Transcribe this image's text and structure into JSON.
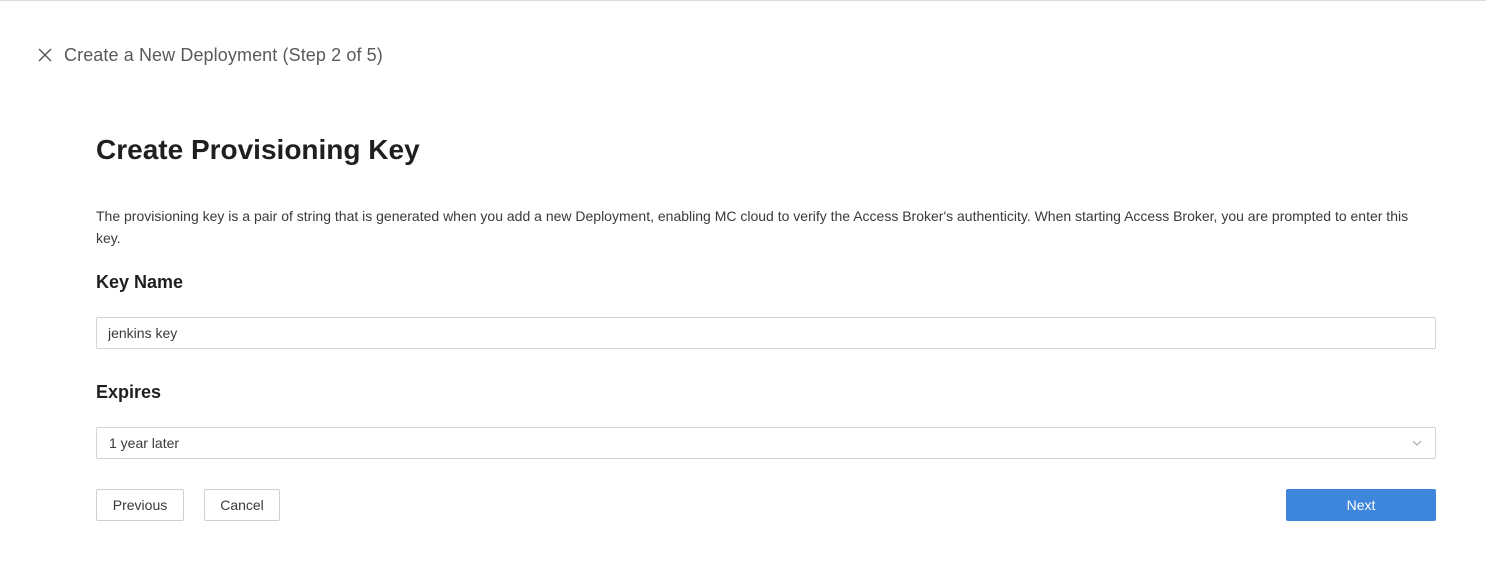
{
  "header": {
    "title": "Create a New Deployment (Step 2 of 5)",
    "close_icon": "close-icon"
  },
  "page": {
    "title": "Create Provisioning Key",
    "description": "The provisioning key is a pair of string that is generated when you add a new Deployment, enabling MC cloud to verify the Access Broker's authenticity. When starting Access Broker, you are prompted to enter this key."
  },
  "form": {
    "key_name": {
      "label": "Key Name",
      "value": "jenkins key"
    },
    "expires": {
      "label": "Expires",
      "selected": "1 year later",
      "icon": "chevron-down-icon"
    }
  },
  "actions": {
    "previous_label": "Previous",
    "cancel_label": "Cancel",
    "next_label": "Next"
  },
  "colors": {
    "primary": "#3e86dc",
    "border": "#d3d3d3",
    "text": "#1f1f1f"
  }
}
